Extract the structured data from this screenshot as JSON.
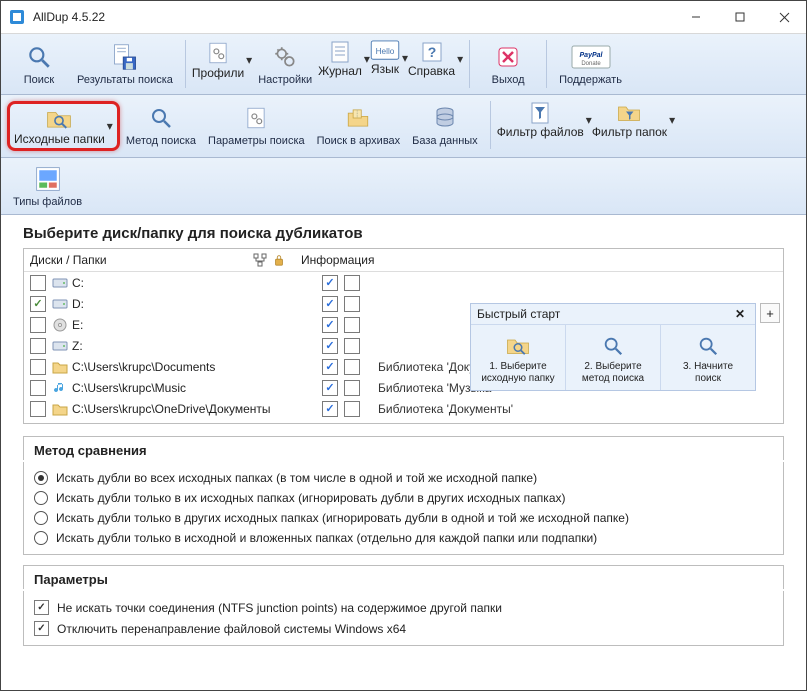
{
  "window": {
    "title": "AllDup 4.5.22"
  },
  "toolbar1": {
    "search": "Поиск",
    "results": "Результаты поиска",
    "profiles": "Профили",
    "settings": "Настройки",
    "journal": "Журнал",
    "language": "Язык",
    "help": "Справка",
    "exit": "Выход",
    "support": "Поддержать"
  },
  "toolbar2": {
    "source_folders": "Исходные папки",
    "search_method": "Метод поиска",
    "search_params": "Параметры поиска",
    "archive_search": "Поиск в архивах",
    "database": "База данных",
    "file_filter": "Фильтр файлов",
    "folder_filter": "Фильтр папок"
  },
  "toolbar3": {
    "file_types": "Типы файлов"
  },
  "main": {
    "heading": "Выберите диск/папку для поиска дубликатов",
    "col_disks": "Диски / Папки",
    "col_info": "Информация"
  },
  "disks": [
    {
      "name": "C:",
      "checked": false,
      "icon": "disk",
      "c1": true,
      "c2": false,
      "info": ""
    },
    {
      "name": "D:",
      "checked": true,
      "icon": "disk",
      "c1": true,
      "c2": false,
      "info": ""
    },
    {
      "name": "E:",
      "checked": false,
      "icon": "cd",
      "c1": true,
      "c2": false,
      "info": ""
    },
    {
      "name": "Z:",
      "checked": false,
      "icon": "disk",
      "c1": true,
      "c2": false,
      "info": ""
    },
    {
      "name": "C:\\Users\\krupc\\Documents",
      "checked": false,
      "icon": "folder",
      "c1": true,
      "c2": false,
      "info": "Библиотека 'Документы'"
    },
    {
      "name": "C:\\Users\\krupc\\Music",
      "checked": false,
      "icon": "music",
      "c1": true,
      "c2": false,
      "info": "Библиотека 'Музыка'"
    },
    {
      "name": "C:\\Users\\krupc\\OneDrive\\Документы",
      "checked": false,
      "icon": "folder",
      "c1": true,
      "c2": false,
      "info": "Библиотека 'Документы'"
    }
  ],
  "quickstart": {
    "title": "Быстрый старт",
    "step1a": "1. Выберите",
    "step1b": "исходную папку",
    "step2a": "2. Выберите",
    "step2b": "метод поиска",
    "step3a": "3. Начните",
    "step3b": "поиск"
  },
  "compare": {
    "title": "Метод сравнения",
    "o1": "Искать дубли во всех исходных папках (в том числе в одной и той же исходной папке)",
    "o2": "Искать дубли только в их исходных папках (игнорировать дубли в других исходных папках)",
    "o3": "Искать дубли только в других исходных папках (игнорировать дубли в одной и той же исходной папке)",
    "o4": "Искать дубли только в исходной и вложенных папках (отдельно для каждой папки или подпапки)"
  },
  "params": {
    "title": "Параметры",
    "p1": "Не искать точки соединения (NTFS junction points) на содержимое другой папки",
    "p2": "Отключить перенаправление файловой системы Windows x64"
  }
}
